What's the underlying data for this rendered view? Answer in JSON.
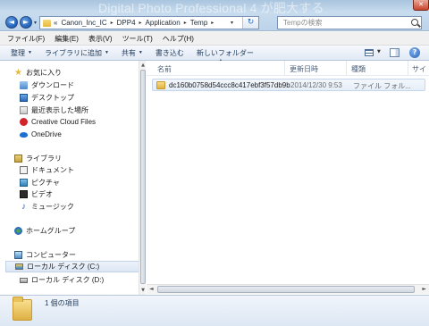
{
  "window": {
    "ghost_title": "Digital Photo Professional 4 が肥大する",
    "close_glyph": "✕"
  },
  "address": {
    "prefix": "«",
    "crumbs": [
      "Canon_Inc_IC",
      "DPP4",
      "Application",
      "Temp"
    ],
    "separator": "▸",
    "dropdown_glyph": "▾",
    "refresh_glyph": "↻"
  },
  "nav_buttons": {
    "back_glyph": "◄",
    "forward_glyph": "►",
    "dropdown_glyph": "▾"
  },
  "search": {
    "placeholder": "Tempの検索"
  },
  "menu": {
    "items": [
      "ファイル(F)",
      "編集(E)",
      "表示(V)",
      "ツール(T)",
      "ヘルプ(H)"
    ]
  },
  "command_bar": {
    "organize": "整理",
    "add_to_library": "ライブラリに追加",
    "share": "共有",
    "burn": "書き込む",
    "new_folder": "新しいフォルダー",
    "dropdown_glyph": "▼",
    "help_glyph": "?"
  },
  "navigation": {
    "favorites": {
      "label": "お気に入り",
      "items": [
        "ダウンロード",
        "デスクトップ",
        "最近表示した場所",
        "Creative Cloud Files",
        "OneDrive"
      ]
    },
    "libraries": {
      "label": "ライブラリ",
      "items": [
        "ドキュメント",
        "ピクチャ",
        "ビデオ",
        "ミュージック"
      ]
    },
    "homegroup": {
      "label": "ホームグループ"
    },
    "computer": {
      "label": "コンピューター",
      "items": [
        "ローカル ディスク (C:)",
        "ローカル ディスク (D:)"
      ],
      "selected_index": 0
    },
    "scroll_up": "▲",
    "scroll_down": "▼"
  },
  "columns": {
    "name": "名前",
    "date_modified": "更新日時",
    "type": "種類",
    "size": "サイ",
    "sort_indicator": "▲"
  },
  "files": [
    {
      "name": "dc160b0758d54ccc8c417ebf3f57db9b",
      "date_modified": "2014/12/30 9:53",
      "type": "ファイル フォル..."
    }
  ],
  "hscroll": {
    "left": "◄",
    "right": "►"
  },
  "details": {
    "item_count": "1 個の項目"
  },
  "icons": {
    "star": "★",
    "music": "♪"
  }
}
